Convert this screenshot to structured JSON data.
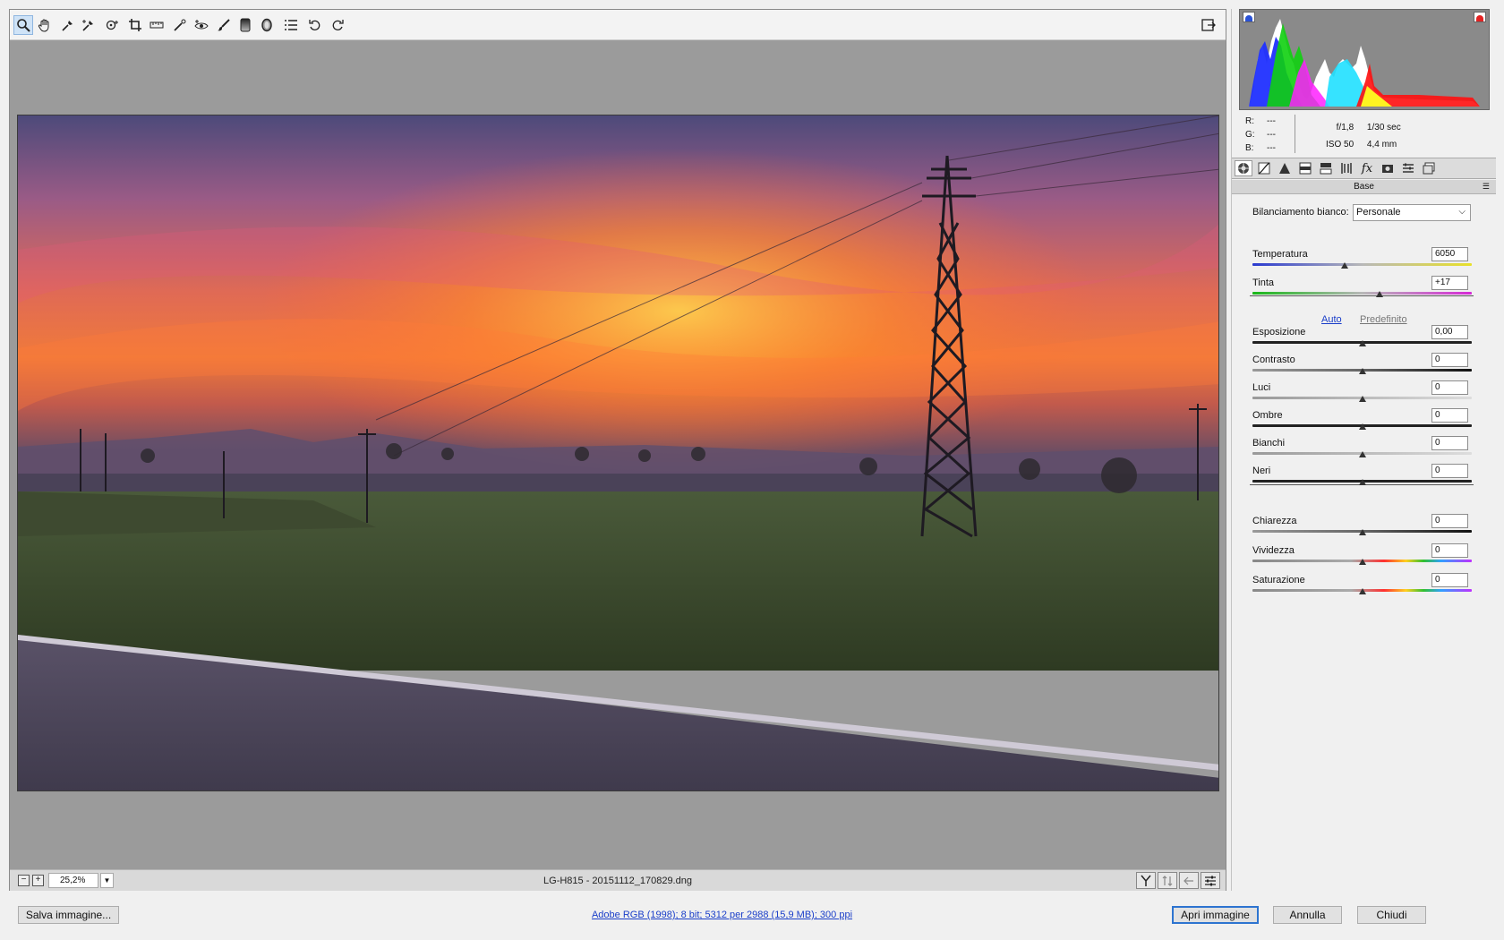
{
  "toolbar": {
    "tools": [
      {
        "name": "zoom-tool",
        "icon": "magnifier-icon",
        "active": true
      },
      {
        "name": "hand-tool",
        "icon": "hand-icon"
      },
      {
        "name": "white-balance-tool",
        "icon": "eyedropper-icon"
      },
      {
        "name": "color-sampler-tool",
        "icon": "eyedropper-plus-icon"
      },
      {
        "name": "targeted-adjustment-tool",
        "icon": "target-icon"
      },
      {
        "name": "crop-tool",
        "icon": "crop-icon"
      },
      {
        "name": "straighten-tool",
        "icon": "level-icon"
      },
      {
        "name": "spot-removal-tool",
        "icon": "brush-spot-icon"
      },
      {
        "name": "red-eye-tool",
        "icon": "eye-icon"
      },
      {
        "name": "adjustment-brush-tool",
        "icon": "brush-icon"
      },
      {
        "name": "graduated-filter-tool",
        "icon": "gradient-rect-icon"
      },
      {
        "name": "radial-filter-tool",
        "icon": "radial-icon"
      },
      {
        "name": "preferences-tool",
        "icon": "list-icon"
      },
      {
        "name": "rotate-left-tool",
        "icon": "rotate-ccw-icon"
      },
      {
        "name": "rotate-right-tool",
        "icon": "rotate-cw-icon"
      }
    ]
  },
  "status": {
    "zoom": "25,2%",
    "filename": "LG-H815  -  20151112_170829.dng"
  },
  "info": {
    "r_label": "R:",
    "g_label": "G:",
    "b_label": "B:",
    "r": "---",
    "g": "---",
    "b": "---",
    "aperture": "f/1,8",
    "shutter": "1/30 sec",
    "iso": "ISO 50",
    "focal": "4,4 mm"
  },
  "panel": {
    "title": "Base",
    "tabs": [
      "base-tab",
      "tone-curve-tab",
      "detail-tab",
      "hsl-tab",
      "split-toning-tab",
      "lens-tab",
      "fx-tab",
      "camera-calibration-tab",
      "presets-tab",
      "snapshots-tab"
    ],
    "wb_label": "Bilanciamento bianco:",
    "wb_value": "Personale",
    "auto": "Auto",
    "default": "Predefinito",
    "sliders": [
      {
        "key": "temperatura",
        "label": "Temperatura",
        "value": "6050",
        "pos": 0.42,
        "gradient": "temp"
      },
      {
        "key": "tinta",
        "label": "Tinta",
        "value": "+17",
        "pos": 0.58,
        "gradient": "tint"
      },
      {
        "key": "esposizione",
        "label": "Esposizione",
        "value": "0,00",
        "pos": 0.5,
        "gradient": "dark"
      },
      {
        "key": "contrasto",
        "label": "Contrasto",
        "value": "0",
        "pos": 0.5,
        "gradient": "contrast"
      },
      {
        "key": "luci",
        "label": "Luci",
        "value": "0",
        "pos": 0.5,
        "gradient": "light"
      },
      {
        "key": "ombre",
        "label": "Ombre",
        "value": "0",
        "pos": 0.5,
        "gradient": "dark"
      },
      {
        "key": "bianchi",
        "label": "Bianchi",
        "value": "0",
        "pos": 0.5,
        "gradient": "light"
      },
      {
        "key": "neri",
        "label": "Neri",
        "value": "0",
        "pos": 0.5,
        "gradient": "dark"
      },
      {
        "key": "chiarezza",
        "label": "Chiarezza",
        "value": "0",
        "pos": 0.5,
        "gradient": "contrast"
      },
      {
        "key": "vividezza",
        "label": "Vividezza",
        "value": "0",
        "pos": 0.5,
        "gradient": "rainbow"
      },
      {
        "key": "saturazione",
        "label": "Saturazione",
        "value": "0",
        "pos": 0.5,
        "gradient": "rainbow"
      }
    ]
  },
  "bottom": {
    "save": "Salva immagine...",
    "workflow": "Adobe RGB (1998); 8 bit; 5312 per 2988 (15,9 MB); 300 ppi",
    "open": "Apri immagine",
    "cancel": "Annulla",
    "close": "Chiudi"
  },
  "colors": {
    "accent": "#2d74d0",
    "link": "#1a3ec9"
  }
}
